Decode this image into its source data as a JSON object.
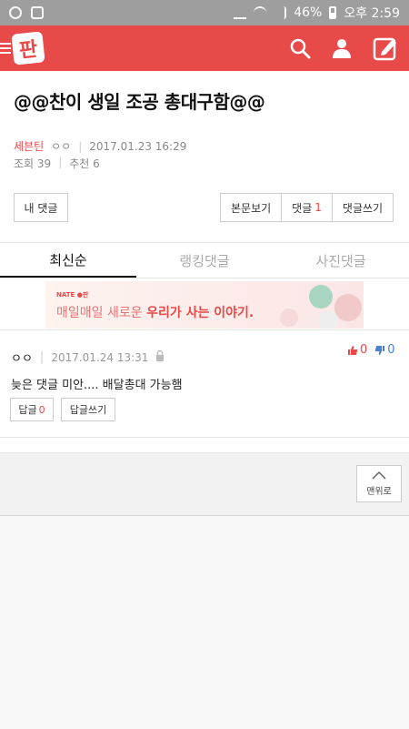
{
  "status_bar": {
    "battery": "46%",
    "time": "오후 2:59"
  },
  "app_bar": {
    "logo_text": "판",
    "icons": [
      "search-icon",
      "profile-icon",
      "write-icon"
    ]
  },
  "post": {
    "title": "@@찬이 생일 조공 총대구함@@",
    "author": "세븐틴",
    "nickname": "ㅇㅇ",
    "datetime": "2017.01.23 16:29",
    "views_label": "조회",
    "views": "39",
    "recommend_label": "추천",
    "recommends": "6"
  },
  "buttons": {
    "my_comments": "내 댓글",
    "view_post": "본문보기",
    "comments_label": "댓글",
    "comments_count": "1",
    "write_comment": "댓글쓰기"
  },
  "tabs": [
    {
      "label": "최신순",
      "active": true
    },
    {
      "label": "랭킹댓글",
      "active": false
    },
    {
      "label": "사진댓글",
      "active": false
    }
  ],
  "banner": {
    "brand": "NATE ●판",
    "text_light": "매일매일 새로운 ",
    "text_bold": "우리가 사는 이야기."
  },
  "comment": {
    "author": "ㅇㅇ",
    "date": "2017.01.24 13:31",
    "body": "늦은 댓글 미안.... 배달총대 가능햄",
    "up": "0",
    "down": "0",
    "reply_label": "답글",
    "reply_count": "0",
    "write_reply": "답글쓰기"
  },
  "to_top": "맨위로",
  "colors": {
    "brand_red": "#e84a4a",
    "status_gray": "#9e9e9e",
    "down_blue": "#4a7fd0"
  }
}
